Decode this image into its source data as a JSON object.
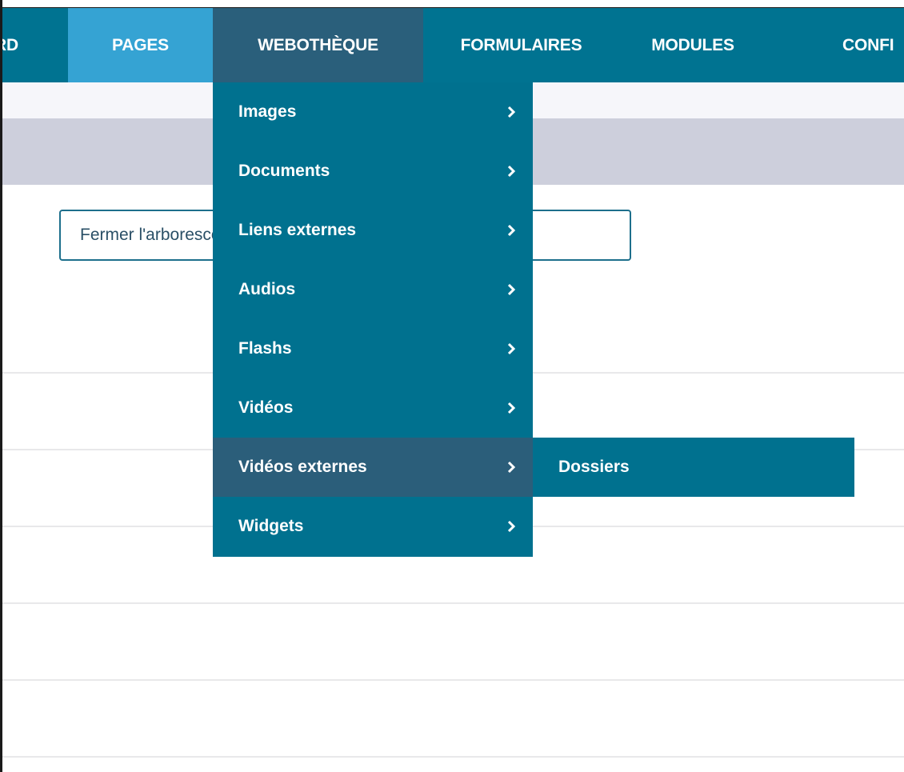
{
  "topnav": {
    "items": [
      {
        "label": "RD"
      },
      {
        "label": "PAGES"
      },
      {
        "label": "WEBOTHÈQUE"
      },
      {
        "label": "FORMULAIRES"
      },
      {
        "label": "MODULES"
      },
      {
        "label": "CONFI"
      }
    ]
  },
  "main": {
    "tree_button_label": "Fermer l'arborescence"
  },
  "dropdown": {
    "items": [
      {
        "label": "Images",
        "icon": "chevron-right-icon"
      },
      {
        "label": "Documents",
        "icon": "chevron-right-icon"
      },
      {
        "label": "Liens externes",
        "icon": "chevron-right-icon"
      },
      {
        "label": "Audios",
        "icon": "chevron-right-icon"
      },
      {
        "label": "Flashs",
        "icon": "chevron-right-icon"
      },
      {
        "label": "Vidéos",
        "icon": "chevron-right-icon"
      },
      {
        "label": "Vidéos externes",
        "icon": "chevron-right-icon"
      },
      {
        "label": "Widgets",
        "icon": "chevron-right-icon"
      }
    ],
    "active_item": "Vidéos externes"
  },
  "submenu": {
    "items": [
      {
        "label": "Dossiers"
      }
    ]
  },
  "colors": {
    "nav_bg": "#007391",
    "pages_tab": "#35a3d3",
    "active_tab": "#2a5f7b",
    "dropdown_bg": "#00718f",
    "dropdown_active": "#2b5e7a",
    "title_bar": "#cdcfdc"
  }
}
